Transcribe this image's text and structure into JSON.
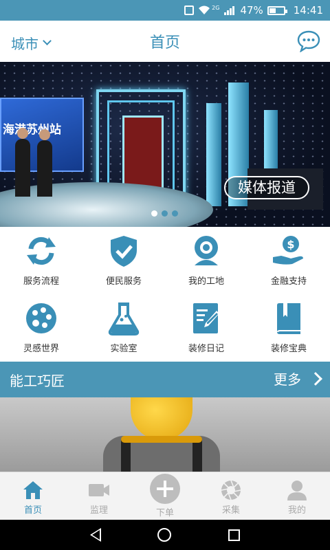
{
  "status_bar": {
    "battery": "47%",
    "battery_level": 0.47,
    "time": "14:41",
    "network": "2G"
  },
  "header": {
    "city_label": "城市",
    "title": "首页"
  },
  "banner": {
    "screen_text": "海港苏州站",
    "tag": "媒体报道",
    "slides": 3,
    "active_slide": 0
  },
  "grid": {
    "items": [
      {
        "label": "服务流程",
        "icon": "refresh-icon"
      },
      {
        "label": "便民服务",
        "icon": "shield-check-icon"
      },
      {
        "label": "我的工地",
        "icon": "webcam-icon"
      },
      {
        "label": "金融支持",
        "icon": "money-hand-icon"
      },
      {
        "label": "灵感世界",
        "icon": "palette-icon"
      },
      {
        "label": "实验室",
        "icon": "flask-icon"
      },
      {
        "label": "装修日记",
        "icon": "notebook-pencil-icon"
      },
      {
        "label": "装修宝典",
        "icon": "book-icon"
      }
    ]
  },
  "section": {
    "title": "能工巧匠",
    "more": "更多"
  },
  "bottom_nav": {
    "items": [
      {
        "label": "首页",
        "icon": "home-icon",
        "active": true
      },
      {
        "label": "监理",
        "icon": "video-camera-icon"
      },
      {
        "label": "下单",
        "icon": "plus-circle-icon"
      },
      {
        "label": "采集",
        "icon": "aperture-icon"
      },
      {
        "label": "我的",
        "icon": "user-icon"
      }
    ]
  },
  "colors": {
    "primary": "#4b96b6",
    "accent": "#3a8fb7",
    "icon_gray": "#bdbdbd"
  }
}
